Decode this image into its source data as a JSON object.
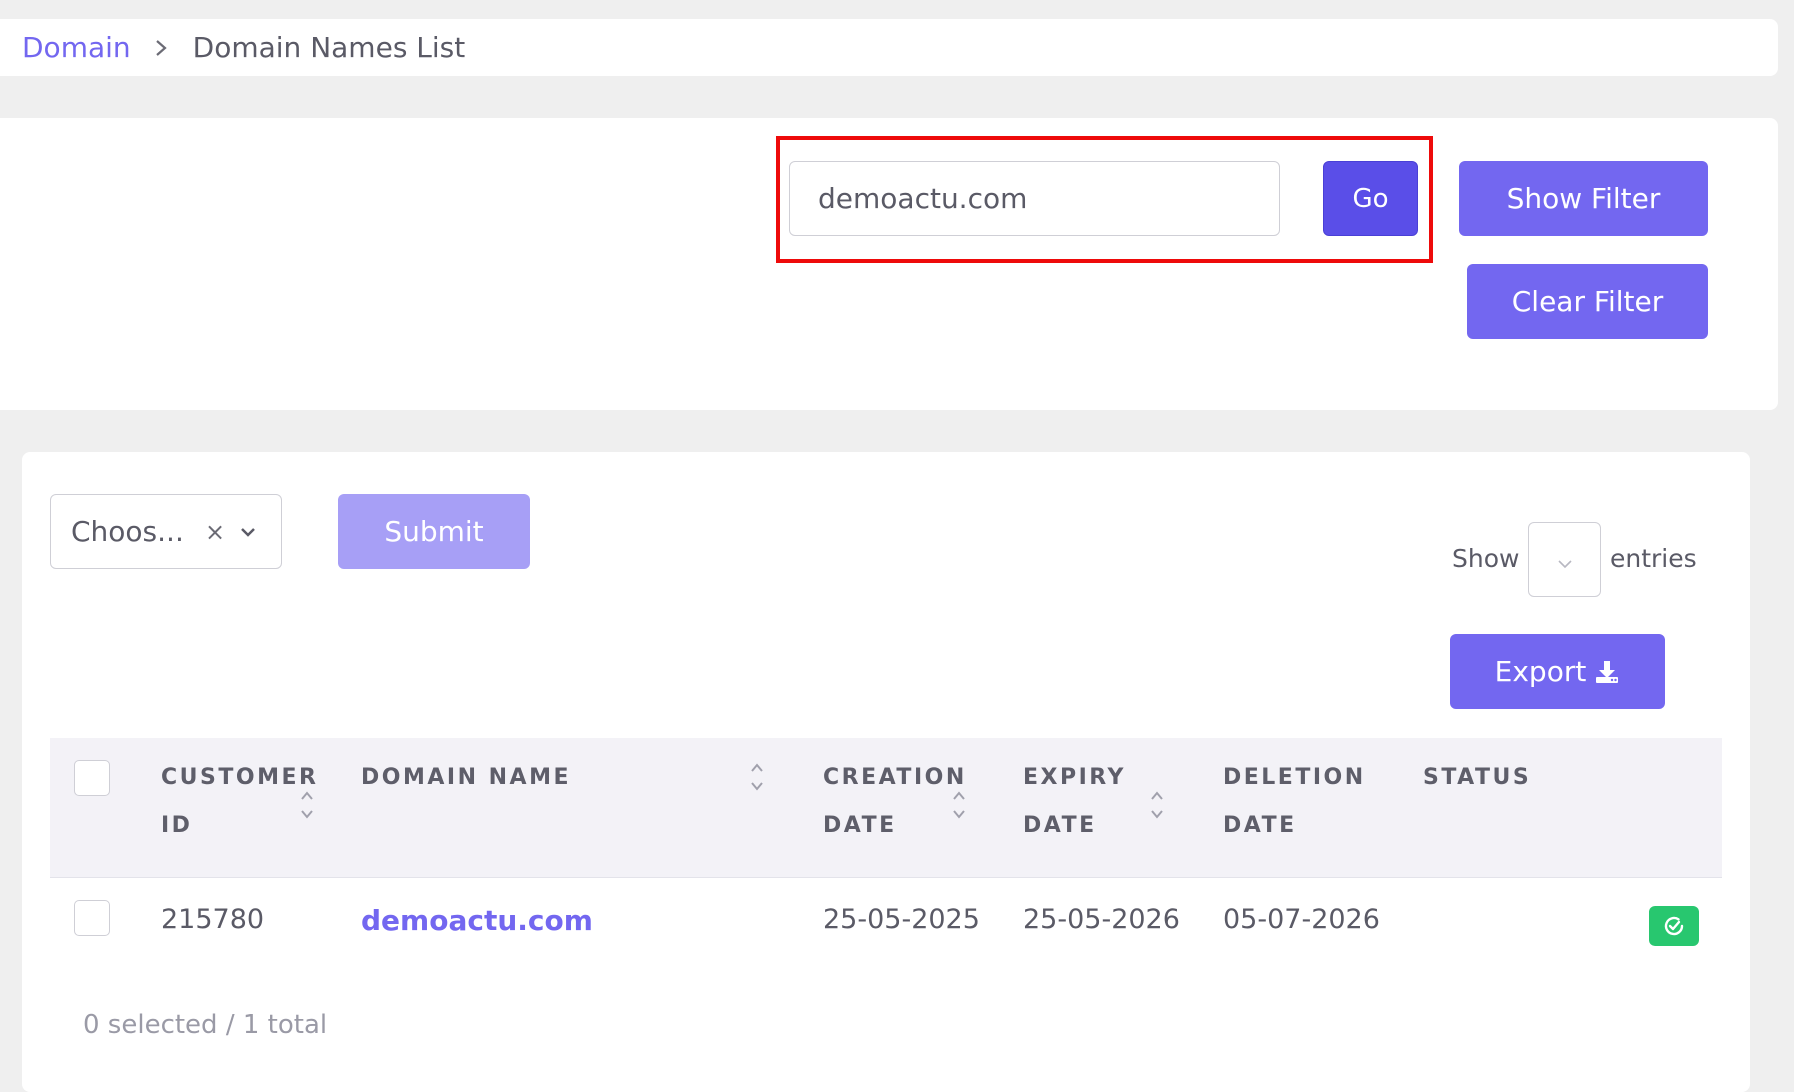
{
  "breadcrumb": {
    "parent": "Domain",
    "current": "Domain Names List"
  },
  "filter": {
    "search_value": "demoactu.com",
    "go_label": "Go",
    "show_filter_label": "Show Filter",
    "clear_filter_label": "Clear Filter"
  },
  "toolbar": {
    "select_value": "Choos...",
    "select_clear": "×",
    "submit_label": "Submit",
    "show_label": "Show",
    "entries_label": "entries",
    "export_label": "Export"
  },
  "table": {
    "columns": [
      {
        "line1": "CUSTOMER",
        "line2": "ID"
      },
      {
        "line1": "DOMAIN NAME",
        "line2": ""
      },
      {
        "line1": "CREATION",
        "line2": "DATE"
      },
      {
        "line1": "EXPIRY",
        "line2": "DATE"
      },
      {
        "line1": "DELETION",
        "line2": "DATE"
      },
      {
        "line1": "STATUS",
        "line2": ""
      }
    ],
    "rows": [
      {
        "customer_id": "215780",
        "domain_name": "demoactu.com",
        "creation_date": "25-05-2025",
        "expiry_date": "25-05-2026",
        "deletion_date": "05-07-2026",
        "status_icon": "check-circle-icon"
      }
    ]
  },
  "footer": {
    "selection_summary": "0 selected / 1 total"
  },
  "colors": {
    "accent": "#7367f0",
    "go_button": "#5a4ee8",
    "submit_disabled": "#a79ff6",
    "status_success": "#28c76f",
    "highlight": "#ee0a0a"
  }
}
